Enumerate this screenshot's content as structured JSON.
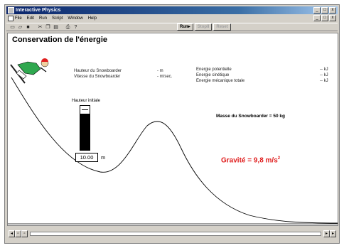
{
  "window": {
    "title": "Interactive Physics",
    "controls": [
      "_",
      "□",
      "x"
    ]
  },
  "menu": {
    "items": [
      "File",
      "Edit",
      "Run",
      "Script",
      "Window",
      "Help"
    ]
  },
  "toolbar": {
    "icons": [
      "new-doc-icon",
      "open-icon",
      "save-icon",
      "cut-icon",
      "copy-icon",
      "paste-icon",
      "print-icon",
      "help-icon"
    ],
    "run_label": "Run▸",
    "stop_label": "StopII",
    "reset_label": "Reset"
  },
  "sim": {
    "title": "Conservation de l'énergie",
    "height_label": "Hauteur du Snowboarder",
    "height_value": "- m",
    "speed_label": "Vitesse du Snowboarder",
    "speed_value": "- m/sec.",
    "potential_label": "Energie potentielle",
    "potential_value": "-- kJ",
    "kinetic_label": "Energie cinétique",
    "kinetic_value": "-- kJ",
    "total_label": "Energie mécanique totale",
    "total_value": "-- kJ",
    "mass_text": "Masse du Snowboarder = 50 kg",
    "gravity_text": "Gravité = 9,8 m/s",
    "gravity_exp": "2",
    "initial_height_label": "Hauteur initiale",
    "initial_height_value": "10.00",
    "initial_height_unit": "m"
  }
}
